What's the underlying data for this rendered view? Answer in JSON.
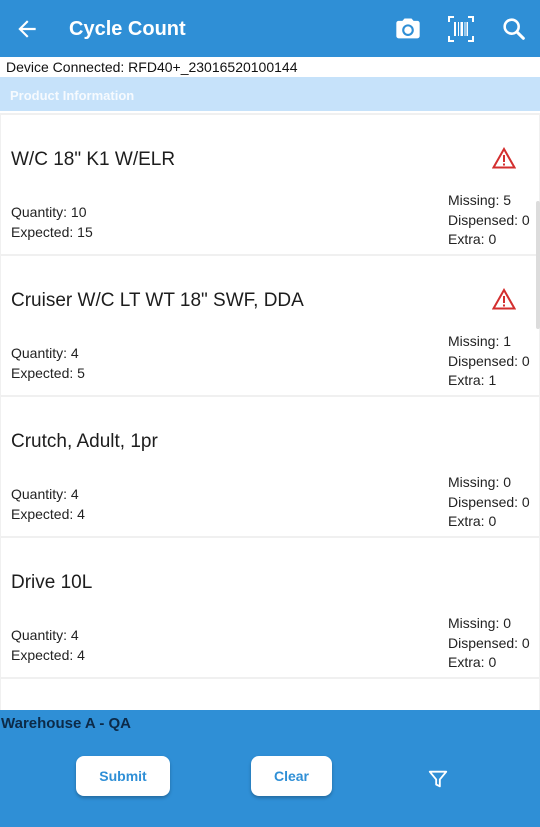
{
  "colors": {
    "accent": "#2f8fd6",
    "section": "#c6e2fa",
    "warning": "#d32f2f"
  },
  "appbar": {
    "title": "Cycle Count",
    "icons": [
      "back-arrow-icon",
      "camera-icon",
      "barcode-scan-icon",
      "search-icon"
    ]
  },
  "device_status": "Device Connected: RFD40+_23016520100144",
  "section_header": "Product Information",
  "items": [
    {
      "name": "W/C 18\" K1 W/ELR",
      "quantity": "Quantity: 10",
      "expected": "Expected: 15",
      "missing": "Missing: 5",
      "dispensed": "Dispensed: 0",
      "extra": "Extra: 0",
      "warning": true
    },
    {
      "name": "Cruiser W/C LT WT 18\" SWF, DDA",
      "quantity": "Quantity: 4",
      "expected": "Expected: 5",
      "missing": "Missing: 1",
      "dispensed": "Dispensed: 0",
      "extra": "Extra: 1",
      "warning": true
    },
    {
      "name": "Crutch, Adult, 1pr",
      "quantity": "Quantity: 4",
      "expected": "Expected: 4",
      "missing": "Missing: 0",
      "dispensed": "Dispensed: 0",
      "extra": "Extra: 0",
      "warning": false
    },
    {
      "name": "Drive 10L",
      "quantity": "Quantity: 4",
      "expected": "Expected: 4",
      "missing": "Missing: 0",
      "dispensed": "Dispensed: 0",
      "extra": "Extra: 0",
      "warning": false
    }
  ],
  "footer": {
    "warehouse": "Warehouse A - QA",
    "submit_label": "Submit",
    "clear_label": "Clear",
    "filter_icon": "filter-icon"
  }
}
